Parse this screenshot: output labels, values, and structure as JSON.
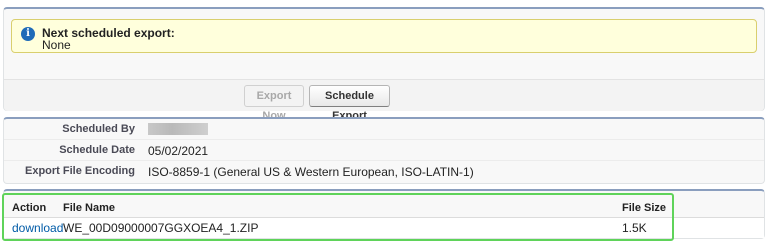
{
  "schedule_notice": {
    "icon": "info-icon",
    "title": "Next scheduled export:",
    "value": "None"
  },
  "buttons": {
    "export_now": "Export Now",
    "schedule_export": "Schedule Export"
  },
  "details": {
    "scheduled_by_label": "Scheduled By",
    "scheduled_by_value": "",
    "schedule_date_label": "Schedule Date",
    "schedule_date_value": "05/02/2021",
    "encoding_label": "Export File Encoding",
    "encoding_value": "ISO-8859-1 (General US & Western European, ISO-LATIN-1)"
  },
  "files_table": {
    "columns": [
      "Action",
      "File Name",
      "File Size"
    ],
    "rows": [
      {
        "action": "download",
        "file_name": "WE_00D09000007GGXOEA4_1.ZIP",
        "file_size": "1.5K"
      }
    ]
  },
  "colors": {
    "panel_accent": "#8a9ebe",
    "info_background": "#ffffdc",
    "link": "#015ba7",
    "highlight": "#5fd35a"
  }
}
